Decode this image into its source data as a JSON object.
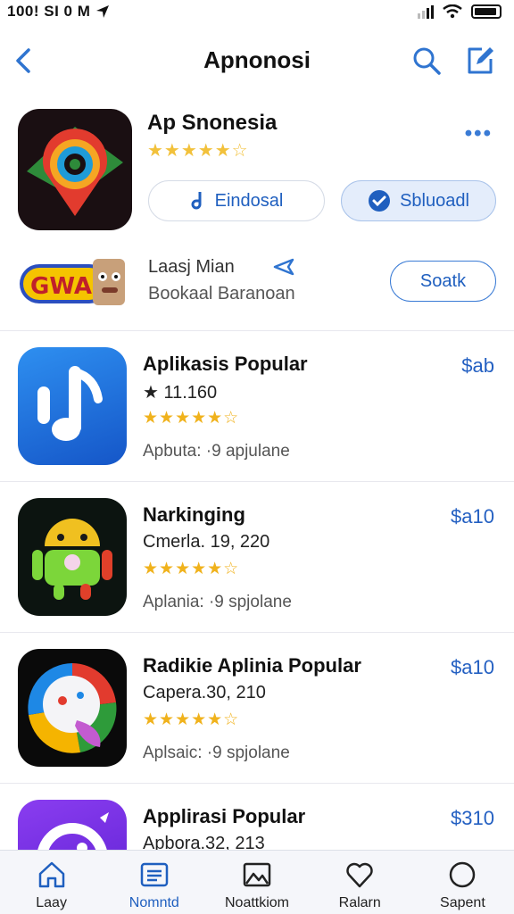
{
  "status_bar": {
    "time_text": "100! SI 0 M"
  },
  "nav": {
    "title": "Apnonosi"
  },
  "hero": {
    "name": "Ap Snonesia",
    "stars": "★★★★★☆",
    "more": "•••",
    "download_label": "Eindosal",
    "upload_label": "Sbluoadl"
  },
  "promo": {
    "title": "Laasj Mian",
    "subtitle": "Bookaal Baranoan",
    "sort_label": "Soatk",
    "logo_text": "GWA"
  },
  "apps": [
    {
      "name": "Aplikasis Popular",
      "meta": "★ 11.160",
      "stars": "★★★★★☆",
      "sub": "Apbuta:  ·9 apjulane",
      "price": "$ab",
      "icon": "music-note-icon"
    },
    {
      "name": "Narkinging",
      "meta": "Cmerla. 19, 220",
      "stars": "★★★★★☆",
      "sub": "Aplania:  ·9 spjolane",
      "price": "$a10",
      "icon": "android-robot-icon"
    },
    {
      "name": "Radikie Aplinia Popular",
      "meta": "Capera.30, 210",
      "stars": "★★★★★☆",
      "sub": "Aplsaic:  ·9 spjolane",
      "price": "$a10",
      "icon": "colorful-face-icon"
    },
    {
      "name": "Applirasi Popular",
      "meta": "Apbora.32, 213",
      "stars": "",
      "sub": "",
      "price": "$310",
      "icon": "purple-app-icon"
    }
  ],
  "tabs": [
    {
      "label": "Laay",
      "icon": "home-icon",
      "active": false
    },
    {
      "label": "Nomntd",
      "icon": "list-icon",
      "active": true
    },
    {
      "label": "Noattkiom",
      "icon": "photo-icon",
      "active": false
    },
    {
      "label": "Ralarn",
      "icon": "heart-icon",
      "active": false
    },
    {
      "label": "Sapent",
      "icon": "circle-icon",
      "active": false
    }
  ],
  "colors": {
    "accent": "#2460c2",
    "star": "#f0b21c",
    "tab_bg": "#f5f6fa"
  }
}
